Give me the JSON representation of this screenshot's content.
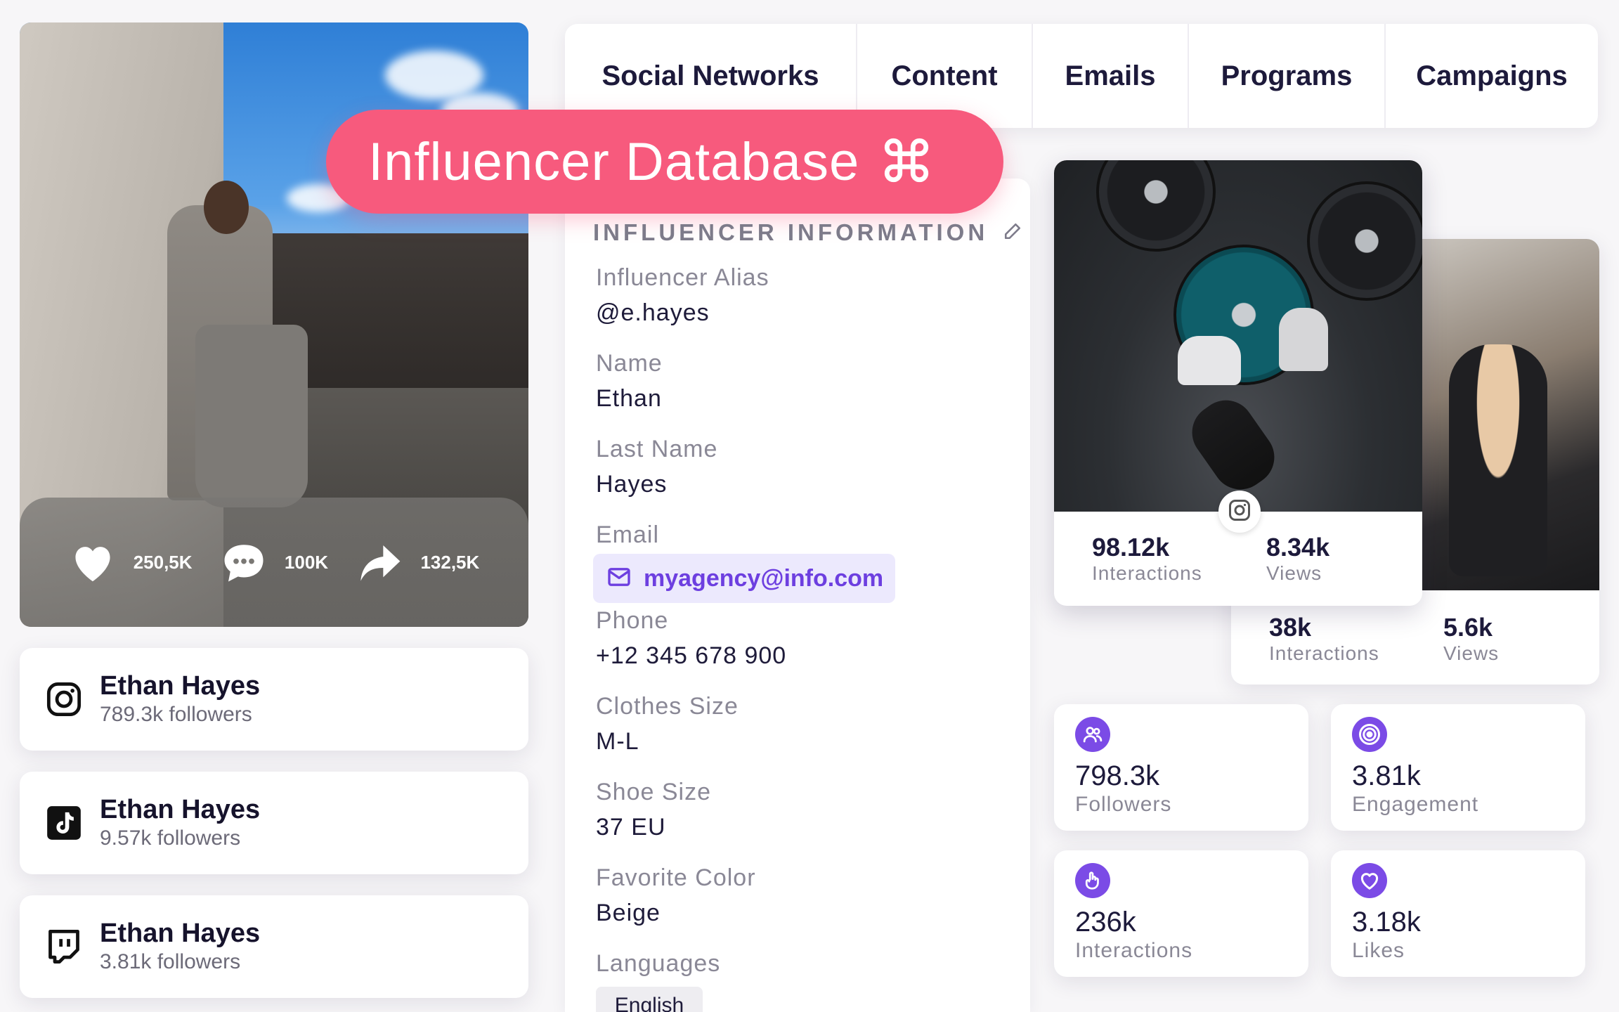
{
  "hero": {
    "likes": "250,5K",
    "comments": "100K",
    "shares": "132,5K"
  },
  "social_accounts": [
    {
      "platform": "instagram",
      "icon": "instagram-icon",
      "name": "Ethan Hayes",
      "followers": "789.3k followers"
    },
    {
      "platform": "tiktok",
      "icon": "tiktok-icon",
      "name": "Ethan Hayes",
      "followers": "9.57k followers"
    },
    {
      "platform": "twitch",
      "icon": "twitch-icon",
      "name": "Ethan Hayes",
      "followers": "3.81k followers"
    }
  ],
  "tabs": [
    "Social Networks",
    "Content",
    "Emails",
    "Programs",
    "Campaigns"
  ],
  "pill": {
    "title": "Influencer Database",
    "icon": "command-icon",
    "color": "#f75a7d"
  },
  "info": {
    "heading": "INFLUENCER INFORMATION",
    "fields": [
      {
        "label": "Influencer Alias",
        "value": "@e.hayes"
      },
      {
        "label": "Name",
        "value": "Ethan"
      },
      {
        "label": "Last Name",
        "value": "Hayes"
      },
      {
        "label": "Email",
        "value": "myagency@info.com"
      },
      {
        "label": "Phone",
        "value": "+12 345 678 900"
      },
      {
        "label": "Clothes Size",
        "value": "M-L"
      },
      {
        "label": "Shoe Size",
        "value": "37 EU"
      },
      {
        "label": "Favorite Color",
        "value": "Beige"
      },
      {
        "label": "Languages",
        "value": "English"
      }
    ]
  },
  "posts": {
    "front": {
      "interactions": "98.12k",
      "interactions_label": "Interactions",
      "views": "8.34k",
      "views_label": "Views"
    },
    "back": {
      "interactions": "38k",
      "interactions_label": "Interactions",
      "views": "5.6k",
      "views_label": "Views"
    }
  },
  "metrics": [
    {
      "icon": "users-icon",
      "value": "798.3k",
      "label": "Followers"
    },
    {
      "icon": "target-icon",
      "value": "3.81k",
      "label": "Engagement"
    },
    {
      "icon": "pointer-icon",
      "value": "236k",
      "label": "Interactions"
    },
    {
      "icon": "heart-icon",
      "value": "3.18k",
      "label": "Likes"
    }
  ],
  "accent": "#7b4be6"
}
